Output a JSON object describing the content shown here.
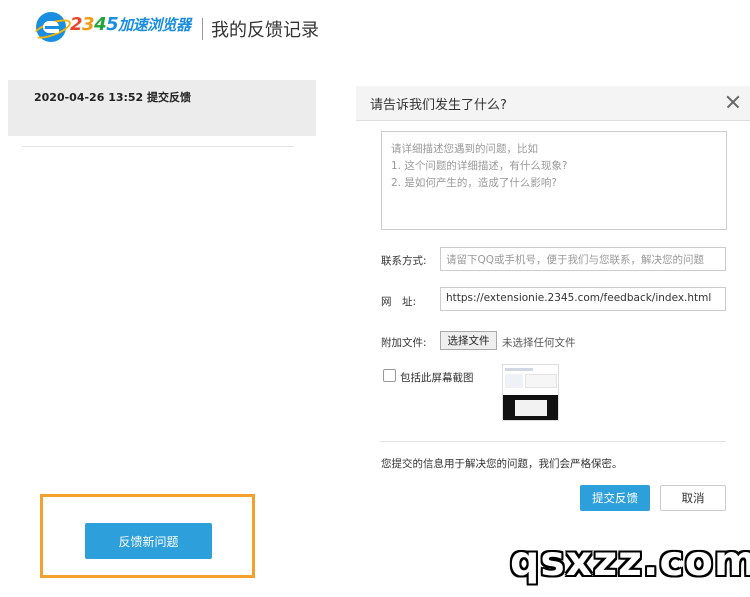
{
  "header": {
    "brand_digits": [
      "2",
      "3",
      "4",
      "5"
    ],
    "brand_cn": "加速浏览器",
    "page_title": "我的反馈记录"
  },
  "records": {
    "items": [
      {
        "label": "2020-04-26 13:52 提交反馈"
      }
    ],
    "new_button": "反馈新问题"
  },
  "dialog": {
    "title": "请告诉我们发生了什么?",
    "description_placeholder": [
      "请详细描述您遇到的问题，比如",
      "1. 这个问题的详细描述，有什么现象?",
      "2. 是如何产生的，造成了什么影响?"
    ],
    "contact": {
      "label": "联系方式:",
      "placeholder": "请留下QQ或手机号，便于我们与您联系，解决您的问题"
    },
    "url": {
      "label": "网　址:",
      "value": "https://extensionie.2345.com/feedback/index.html"
    },
    "attachment": {
      "label": "附加文件:",
      "button": "选择文件",
      "status": "未选择任何文件"
    },
    "screenshot": {
      "label": "包括此屏幕截图",
      "checked": false
    },
    "note": "您提交的信息用于解决您的问题，我们会严格保密。",
    "submit": "提交反馈",
    "cancel": "取消"
  },
  "watermark": "qsxzz.com",
  "colors": {
    "accent_blue": "#2d9fdb",
    "highlight_orange": "#f4a02c",
    "record_bg": "#ececec"
  },
  "icons": [
    "browser-logo-icon",
    "close-icon"
  ]
}
